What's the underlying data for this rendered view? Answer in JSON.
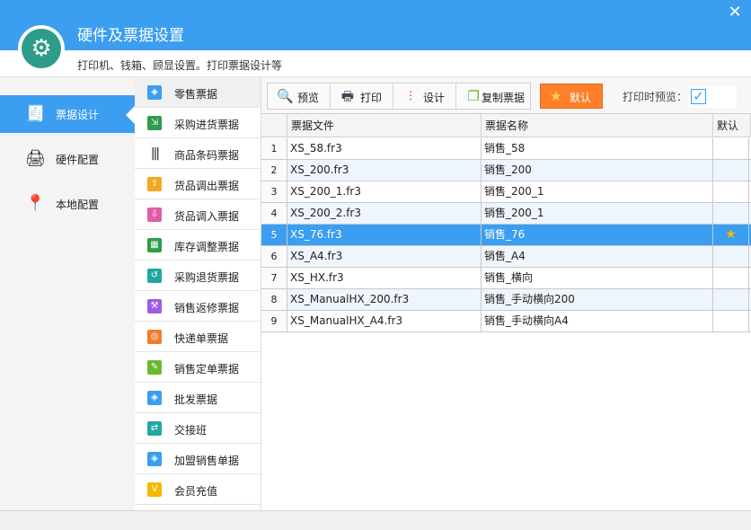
{
  "window": {
    "title": "硬件及票据设置",
    "subtitle": "打印机、钱箱、顾显设置。打印票据设计等",
    "close_icon": "close-icon",
    "logo_icon": "gear-icon"
  },
  "colors": {
    "accent": "#3b9ef0",
    "default_button": "#ff7f2a",
    "selected_row": "#3b9ef0",
    "star": "#f5b800"
  },
  "left_nav": {
    "items": [
      {
        "label": "票据设计",
        "icon": "receipt-icon",
        "active": true
      },
      {
        "label": "硬件配置",
        "icon": "printer-icon",
        "active": false
      },
      {
        "label": "本地配置",
        "icon": "location-pin-icon",
        "active": false
      }
    ]
  },
  "mid_list": {
    "items": [
      {
        "label": "零售票据",
        "icon": "tag-icon",
        "color": "#3b9ef0"
      },
      {
        "label": "采购进货票据",
        "icon": "cart-in-icon",
        "color": "#2e9c4a"
      },
      {
        "label": "商品条码票据",
        "icon": "barcode-icon",
        "color": "#222222"
      },
      {
        "label": "货品调出票据",
        "icon": "box-out-icon",
        "color": "#f5a623"
      },
      {
        "label": "货品调入票据",
        "icon": "box-in-icon",
        "color": "#e45aa8"
      },
      {
        "label": "库存调整票据",
        "icon": "grid-icon",
        "color": "#2e9c4a"
      },
      {
        "label": "采购退货票据",
        "icon": "cart-return-icon",
        "color": "#20a8a0"
      },
      {
        "label": "销售返修票据",
        "icon": "wrench-icon",
        "color": "#a05ae4"
      },
      {
        "label": "快递单票据",
        "icon": "globe-icon",
        "color": "#f07d2a"
      },
      {
        "label": "销售定单票据",
        "icon": "order-icon",
        "color": "#6cb82e"
      },
      {
        "label": "批发票据",
        "icon": "tag-icon",
        "color": "#3b9ef0"
      },
      {
        "label": "交接班",
        "icon": "handover-icon",
        "color": "#20a8a0"
      },
      {
        "label": "加盟销售单据",
        "icon": "tag-icon",
        "color": "#3b9ef0"
      },
      {
        "label": "会员充值",
        "icon": "v-icon",
        "color": "#f5b800"
      }
    ]
  },
  "toolbar": {
    "preview_label": "预览",
    "print_label": "打印",
    "design_label": "设计",
    "copy_label": "复制票据",
    "default_label": "默认",
    "print_preview_label": "打印时预览：",
    "print_preview_checked": true,
    "check_mark": "✓"
  },
  "grid": {
    "headers": {
      "file": "票据文件",
      "name": "票据名称",
      "default": "默认"
    },
    "rows": [
      {
        "num": "1",
        "file": "XS_58.fr3",
        "name": "销售_58",
        "default": ""
      },
      {
        "num": "2",
        "file": "XS_200.fr3",
        "name": "销售_200",
        "default": ""
      },
      {
        "num": "3",
        "file": "XS_200_1.fr3",
        "name": "销售_200_1",
        "default": ""
      },
      {
        "num": "4",
        "file": "XS_200_2.fr3",
        "name": "销售_200_1",
        "default": ""
      },
      {
        "num": "5",
        "file": "XS_76.fr3",
        "name": "销售_76",
        "default": "★"
      },
      {
        "num": "6",
        "file": "XS_A4.fr3",
        "name": "销售_A4",
        "default": ""
      },
      {
        "num": "7",
        "file": "XS_HX.fr3",
        "name": "销售_横向",
        "default": ""
      },
      {
        "num": "8",
        "file": "XS_ManualHX_200.fr3",
        "name": "销售_手动横向200",
        "default": ""
      },
      {
        "num": "9",
        "file": "XS_ManualHX_A4.fr3",
        "name": "销售_手动横向A4",
        "default": ""
      }
    ],
    "selected_row": 4
  }
}
